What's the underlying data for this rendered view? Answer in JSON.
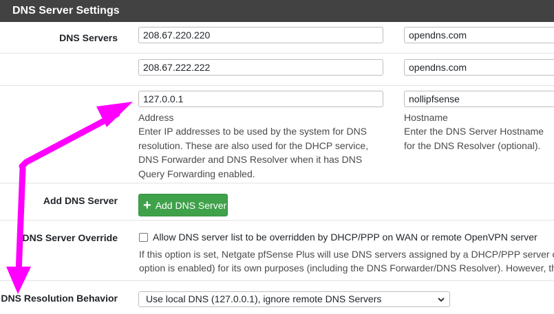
{
  "panel": {
    "title": "DNS Server Settings"
  },
  "dns_servers": {
    "label": "DNS Servers",
    "rows": [
      {
        "address": "208.67.220.220",
        "hostname": "opendns.com"
      },
      {
        "address": "208.67.222.222",
        "hostname": "opendns.com"
      },
      {
        "address": "127.0.0.1",
        "hostname": "nollipfsense"
      }
    ],
    "address_label": "Address",
    "address_help": "Enter IP addresses to be used by the system for DNS resolution. These are also used for the DHCP service, DNS Forwarder and DNS Resolver when it has DNS Query Forwarding enabled.",
    "hostname_label": "Hostname",
    "hostname_help": "Enter the DNS Server Hostname for the DNS Resolver (optional)."
  },
  "add_dns": {
    "label": "Add DNS Server",
    "button_label": "Add DNS Server"
  },
  "override": {
    "label": "DNS Server Override",
    "checkbox_label": "Allow DNS server list to be overridden by DHCP/PPP on WAN or remote OpenVPN server",
    "help": "If this option is set, Netgate pfSense Plus will use DNS servers assigned by a DHCP/PPP server on WAN for its own purposes (including the DNS Forwarder/DNS Resolver). However, they will not be assigned to DHCP clients. option is enabled) for its own purposes (including the DNS Forwarder/DNS Resolver). However, they",
    "help_line1": "If this option is set, Netgate pfSense Plus will use DNS servers assigned by a DHCP/PPP server or",
    "help_line2": "option is enabled) for its own purposes (including the DNS Forwarder/DNS Resolver). However, they"
  },
  "resolution": {
    "label": "DNS Resolution Behavior",
    "selected": "Use local DNS (127.0.0.1), ignore remote DNS Servers"
  },
  "colors": {
    "heading": "#424242",
    "success": "#3fa14a",
    "annotation": "#ff00ff"
  }
}
